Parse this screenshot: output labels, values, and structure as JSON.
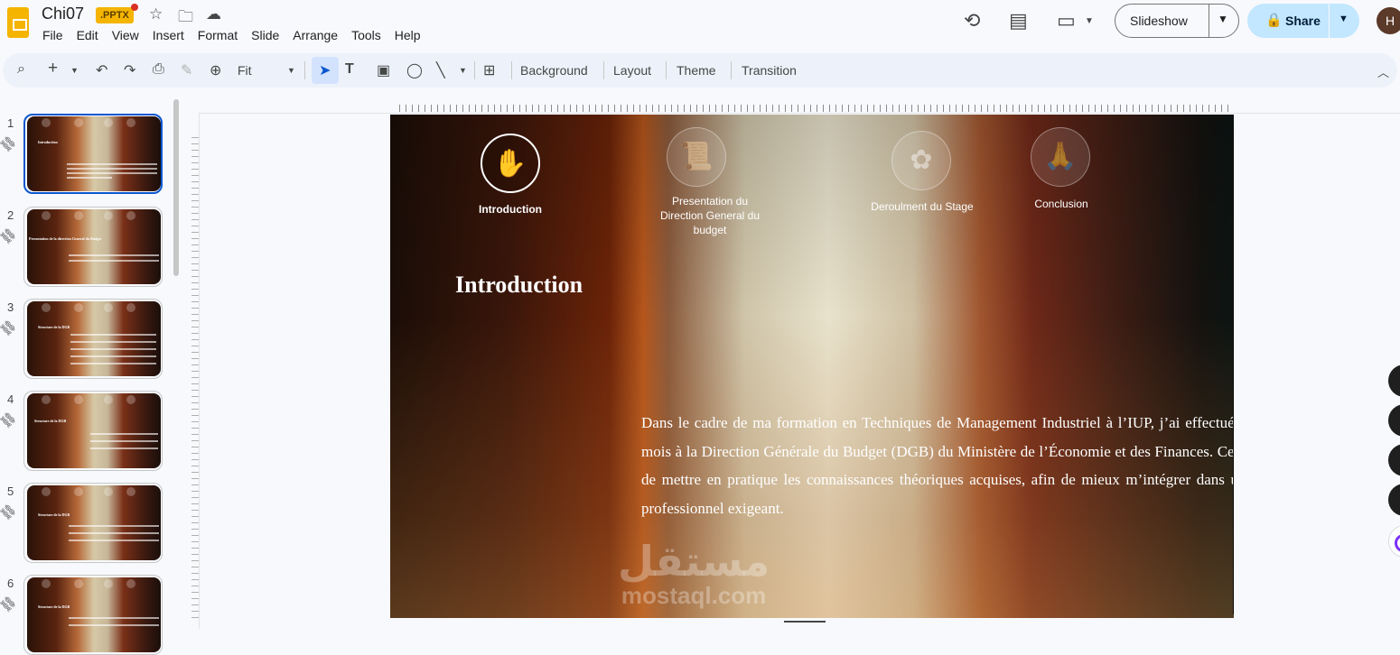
{
  "document": {
    "title": "Chi07",
    "format_badge": ".PPTX"
  },
  "menu": [
    "File",
    "Edit",
    "View",
    "Insert",
    "Format",
    "Slide",
    "Arrange",
    "Tools",
    "Help"
  ],
  "header": {
    "slideshow_label": "Slideshow",
    "share_label": "Share",
    "avatar_letter": "H"
  },
  "toolbar": {
    "zoom_value": "Fit",
    "background_label": "Background",
    "layout_label": "Layout",
    "theme_label": "Theme",
    "transition_label": "Transition"
  },
  "filmstrip": {
    "slides": [
      {
        "number": "1",
        "active": true
      },
      {
        "number": "2",
        "active": false
      },
      {
        "number": "3",
        "active": false
      },
      {
        "number": "4",
        "active": false
      },
      {
        "number": "5",
        "active": false
      },
      {
        "number": "6",
        "active": false
      }
    ]
  },
  "slide": {
    "nav": [
      {
        "label": "Introduction",
        "icon": "waving-hand-icon",
        "active": true
      },
      {
        "label": "Presentation du Direction General du budget",
        "icon": "scroll-icon",
        "active": false
      },
      {
        "label": "Deroulment du Stage",
        "icon": "lotus-icon",
        "active": false
      },
      {
        "label": "Conclusion",
        "icon": "praying-hands-icon",
        "active": false
      }
    ],
    "title": "Introduction",
    "body": "Dans le cadre de ma formation en Techniques de Management Industriel à l’IUP, j’ai effectué un stage de trois mois à la Direction Générale du Budget (DGB) du Ministère de l’Économie et des Finances. Ce stage m’a permis de mettre en pratique les connaissances théoriques acquises, afin de mieux m’intégrer dans un environnement professionnel exigeant.",
    "watermark_ar": "مستقل",
    "watermark_en": "mostaql.com"
  },
  "colors": {
    "accent": "#0b57d0",
    "share_bg": "#c2e7ff",
    "logo": "#f4b400"
  }
}
